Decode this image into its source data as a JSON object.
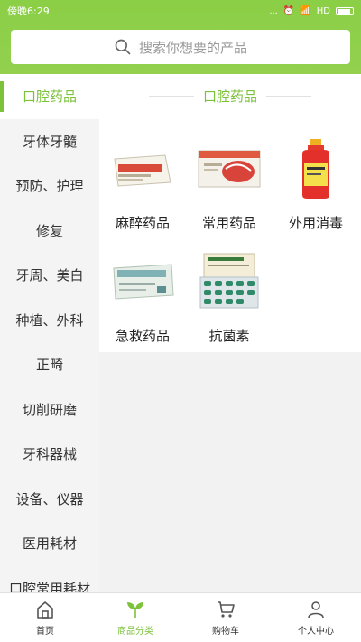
{
  "status_bar": {
    "carrier": "傍晚6:29",
    "network": "...",
    "hd": "HD"
  },
  "search": {
    "placeholder": "搜索你想要的产品"
  },
  "sidebar": {
    "items": [
      {
        "label": "口腔药品",
        "active": true
      },
      {
        "label": "牙体牙髓"
      },
      {
        "label": "预防、护理"
      },
      {
        "label": "修复"
      },
      {
        "label": "牙周、美白"
      },
      {
        "label": "种植、外科"
      },
      {
        "label": "正畸"
      },
      {
        "label": "切削研磨"
      },
      {
        "label": "牙科器械"
      },
      {
        "label": "设备、仪器"
      },
      {
        "label": "医用耗材"
      },
      {
        "label": "口腔常用耗材"
      }
    ]
  },
  "main": {
    "section_title": "口腔药品",
    "products": [
      {
        "label": "麻醉药品",
        "icon": "anesthetic-box-image"
      },
      {
        "label": "常用药品",
        "icon": "common-medicine-box-image"
      },
      {
        "label": "外用消毒",
        "icon": "disinfectant-bottle-image"
      },
      {
        "label": "急救药品",
        "icon": "first-aid-box-image"
      },
      {
        "label": "抗菌素",
        "icon": "antibiotic-blister-image"
      }
    ]
  },
  "bottom_nav": {
    "tabs": [
      {
        "label": "首页",
        "icon": "home-icon"
      },
      {
        "label": "商品分类",
        "icon": "category-leaf-icon",
        "active": true
      },
      {
        "label": "购物车",
        "icon": "cart-icon"
      },
      {
        "label": "个人中心",
        "icon": "user-icon"
      }
    ]
  },
  "colors": {
    "accent": "#7cc23a",
    "header": "#8bcf46"
  }
}
